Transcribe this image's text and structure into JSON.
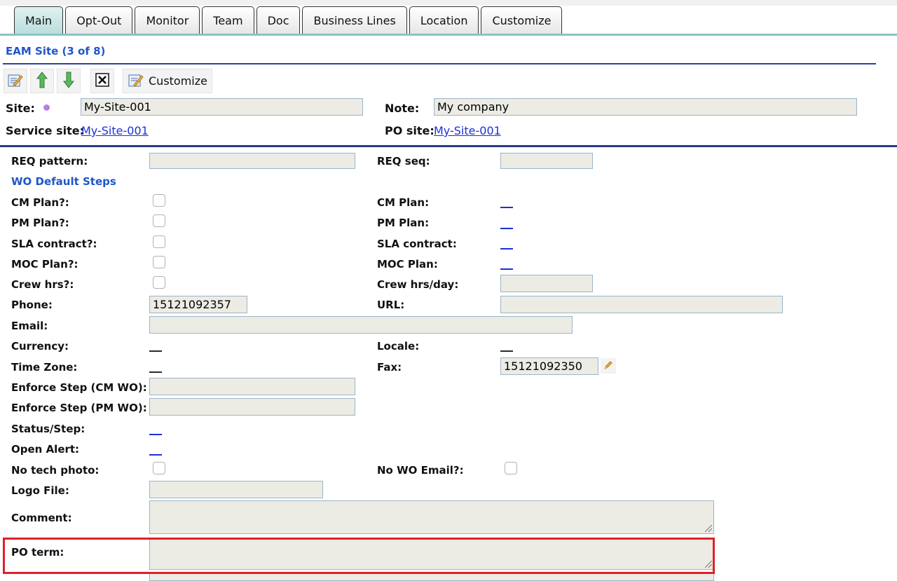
{
  "tabs": [
    "Main",
    "Opt-Out",
    "Monitor",
    "Team",
    "Doc",
    "Business Lines",
    "Location",
    "Customize"
  ],
  "active_tab": "Main",
  "record_title": "EAM Site (3 of 8)",
  "toolbar": {
    "edit_icon": "edit-note-icon",
    "up_icon": "arrow-up-icon",
    "down_icon": "arrow-down-icon",
    "close_icon": "close-box-icon",
    "customize_label": "Customize"
  },
  "header": {
    "site_label": "Site:",
    "site_value": "My-Site-001",
    "note_label": "Note:",
    "note_value": "My company",
    "service_site_label": "Service site:",
    "service_site_link": "My-Site-001",
    "po_site_label": "PO site:",
    "po_site_link": "My-Site-001"
  },
  "form": {
    "req_pattern_label": "REQ pattern:",
    "req_pattern_value": "",
    "req_seq_label": "REQ seq:",
    "req_seq_value": "",
    "wo_default_steps": "WO Default Steps",
    "cm_plan_q_label": "CM Plan?:",
    "cm_plan_label": "CM Plan:",
    "pm_plan_q_label": "PM Plan?:",
    "pm_plan_label": "PM Plan:",
    "sla_contract_q_label": "SLA contract?:",
    "sla_contract_label": "SLA contract:",
    "moc_plan_q_label": "MOC Plan?:",
    "moc_plan_label": "MOC Plan:",
    "crew_hrs_q_label": "Crew hrs?:",
    "crew_hrs_day_label": "Crew hrs/day:",
    "crew_hrs_day_value": "",
    "phone_label": "Phone:",
    "phone_value": "15121092357",
    "url_label": "URL:",
    "url_value": "",
    "email_label": "Email:",
    "email_value": "",
    "currency_label": "Currency:",
    "locale_label": "Locale:",
    "time_zone_label": "Time Zone:",
    "fax_label": "Fax:",
    "fax_value": "15121092350",
    "enforce_cm_label": "Enforce Step (CM WO):",
    "enforce_cm_value": "",
    "enforce_pm_label": "Enforce Step (PM WO):",
    "enforce_pm_value": "",
    "status_step_label": "Status/Step:",
    "open_alert_label": "Open Alert:",
    "no_tech_photo_label": "No tech photo:",
    "no_wo_email_label": "No WO Email?:",
    "logo_file_label": "Logo File:",
    "logo_file_value": "",
    "comment_label": "Comment:",
    "comment_value": "",
    "po_term_label": "PO term:",
    "po_term_value": ""
  },
  "colors": {
    "accent_blue": "#1f56c7",
    "link_blue": "#1a32d6",
    "highlight_red": "#e0202a",
    "input_bg": "#ecebe4",
    "active_tab_bg": "#b9dddd"
  }
}
